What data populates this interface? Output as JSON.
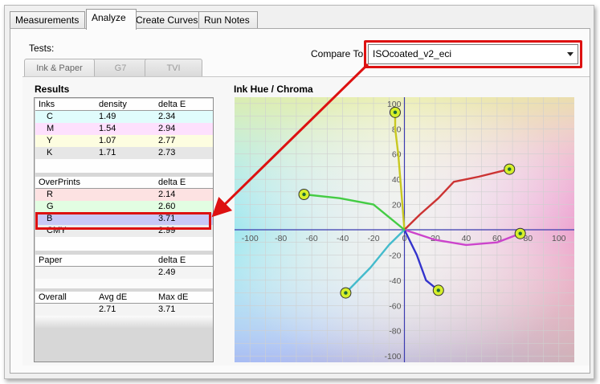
{
  "tabs": [
    {
      "label": "Measurements",
      "active": false
    },
    {
      "label": "Analyze",
      "active": true
    },
    {
      "label": "Create Curves",
      "active": false
    },
    {
      "label": "Run Notes",
      "active": false
    }
  ],
  "tests_label": "Tests:",
  "subtabs": [
    {
      "label": "Ink & Paper",
      "active": true
    },
    {
      "label": "G7",
      "active": false
    },
    {
      "label": "TVI",
      "active": false
    }
  ],
  "compare": {
    "label": "Compare To",
    "value": "ISOcoated_v2_eci"
  },
  "results": {
    "title": "Results",
    "inks": {
      "headers": [
        "Inks",
        "density",
        "delta E"
      ],
      "rows": [
        {
          "name": "C",
          "density": "1.49",
          "delta": "2.34",
          "color": "#e0fcfc"
        },
        {
          "name": "M",
          "density": "1.54",
          "delta": "2.94",
          "color": "#fde0fd"
        },
        {
          "name": "Y",
          "density": "1.07",
          "delta": "2.77",
          "color": "#fdfde0"
        },
        {
          "name": "K",
          "density": "1.71",
          "delta": "2.73",
          "color": "#e6e6e6"
        }
      ]
    },
    "overprints": {
      "headers": [
        "OverPrints",
        "",
        "delta E"
      ],
      "rows": [
        {
          "name": "R",
          "delta": "2.14",
          "color": "#fde2e2"
        },
        {
          "name": "G",
          "delta": "2.60",
          "color": "#e2fde2"
        },
        {
          "name": "B",
          "delta": "3.71",
          "color": "#c8c8f6"
        },
        {
          "name": "CMY",
          "delta": "2.99",
          "color": "#ececec"
        }
      ]
    },
    "paper": {
      "headers": [
        "Paper",
        "",
        "delta E"
      ],
      "value": "2.49"
    },
    "overall": {
      "headers": [
        "Overall",
        "Avg dE",
        "Max dE"
      ],
      "avg": "2.71",
      "max": "3.71"
    }
  },
  "chart_data": {
    "type": "line",
    "title": "Ink Hue / Chroma",
    "xlabel": "",
    "ylabel": "",
    "xlim": [
      -110,
      110
    ],
    "ylim": [
      -105,
      105
    ],
    "x_ticks": [
      -100,
      -80,
      -60,
      -40,
      -20,
      0,
      20,
      40,
      60,
      80,
      100
    ],
    "y_ticks": [
      -100,
      -80,
      -60,
      -40,
      -20,
      20,
      40,
      60,
      80,
      100
    ],
    "grid": true,
    "series": [
      {
        "color": "#c8c820",
        "points": [
          [
            0,
            0
          ],
          [
            -2,
            30
          ],
          [
            -4,
            60
          ],
          [
            -6,
            80
          ],
          [
            -6,
            93
          ]
        ]
      },
      {
        "color": "#cc3333",
        "points": [
          [
            0,
            0
          ],
          [
            10,
            12
          ],
          [
            22,
            25
          ],
          [
            32,
            38
          ],
          [
            48,
            42
          ],
          [
            68,
            48
          ]
        ]
      },
      {
        "color": "#cc44cc",
        "points": [
          [
            0,
            0
          ],
          [
            20,
            -8
          ],
          [
            40,
            -12
          ],
          [
            60,
            -10
          ],
          [
            75,
            -3
          ]
        ]
      },
      {
        "color": "#3333cc",
        "points": [
          [
            0,
            0
          ],
          [
            8,
            -20
          ],
          [
            14,
            -40
          ],
          [
            22,
            -48
          ]
        ]
      },
      {
        "color": "#44bbcc",
        "points": [
          [
            0,
            0
          ],
          [
            -10,
            -12
          ],
          [
            -22,
            -30
          ],
          [
            -38,
            -50
          ]
        ]
      },
      {
        "color": "#44cc44",
        "points": [
          [
            0,
            0
          ],
          [
            -10,
            10
          ],
          [
            -20,
            20
          ],
          [
            -42,
            25
          ],
          [
            -65,
            28
          ]
        ]
      }
    ],
    "end_markers": [
      [
        -6,
        93
      ],
      [
        68,
        48
      ],
      [
        75,
        -3
      ],
      [
        22,
        -48
      ],
      [
        -38,
        -50
      ],
      [
        -65,
        28
      ]
    ]
  }
}
